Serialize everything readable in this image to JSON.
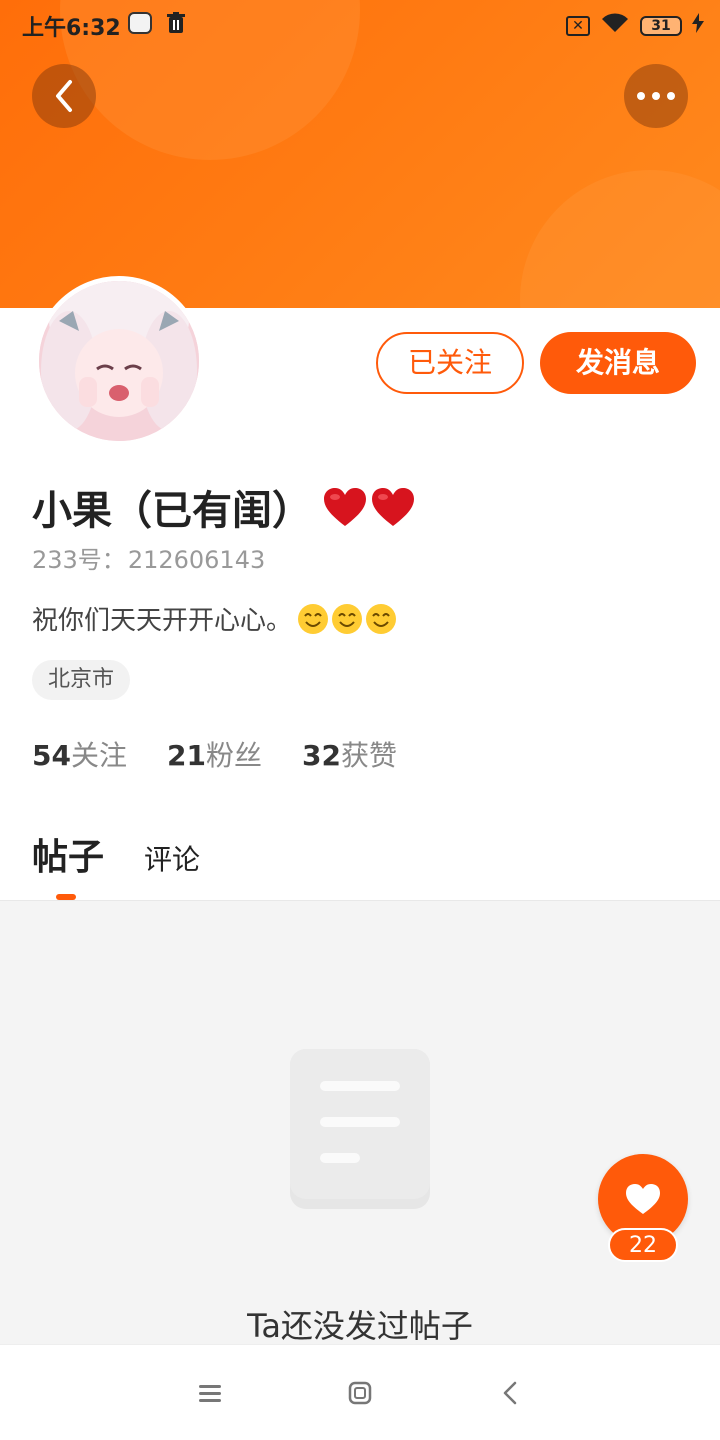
{
  "status_bar": {
    "time": "上午6:32",
    "battery": "31",
    "sim": "✕"
  },
  "header": {
    "back_icon": "chevron-left-icon",
    "more_icon": "more-dots-icon"
  },
  "profile": {
    "name": "小果（已有闺）",
    "id_label": "233号：",
    "id_value": "212606143",
    "bio": "祝你们天天开开心心。",
    "location": "北京市",
    "follow_state_label": "已关注",
    "message_label": "发消息",
    "stats": [
      {
        "value": "54",
        "label": "关注"
      },
      {
        "value": "21",
        "label": "粉丝"
      },
      {
        "value": "32",
        "label": "获赞"
      }
    ]
  },
  "tabs": [
    {
      "label": "帖子",
      "active": true
    },
    {
      "label": "评论",
      "active": false
    }
  ],
  "empty_state": {
    "text": "Ta还没发过帖子"
  },
  "like": {
    "count": "22"
  },
  "colors": {
    "accent": "#ff5a0a",
    "header_gradient_start": "#ff6e0a",
    "header_gradient_end": "#ff8a1e"
  }
}
